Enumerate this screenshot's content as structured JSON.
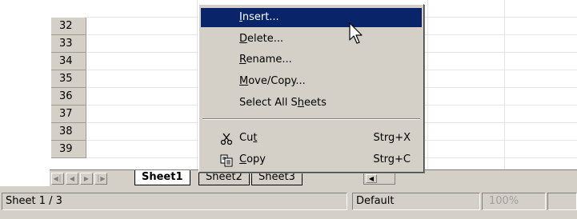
{
  "grid": {
    "rows": [
      "32",
      "33",
      "34",
      "35",
      "36",
      "37",
      "38",
      "39"
    ]
  },
  "context_menu": {
    "items": [
      {
        "pre": "",
        "mn": "I",
        "post": "nsert...",
        "shortcut": ""
      },
      {
        "pre": "",
        "mn": "D",
        "post": "elete...",
        "shortcut": ""
      },
      {
        "pre": "",
        "mn": "R",
        "post": "ename...",
        "shortcut": ""
      },
      {
        "pre": "",
        "mn": "M",
        "post": "ove/Copy...",
        "shortcut": ""
      },
      {
        "pre": "Select All S",
        "mn": "h",
        "post": "eets",
        "shortcut": ""
      },
      {
        "pre": "Cu",
        "mn": "t",
        "post": "",
        "shortcut": "Strg+X"
      },
      {
        "pre": "",
        "mn": "C",
        "post": "opy",
        "shortcut": "Strg+C"
      }
    ]
  },
  "sheet_tabs": [
    "Sheet1",
    "Sheet2",
    "Sheet3"
  ],
  "status": {
    "sheet_info": "Sheet 1 / 3",
    "page_style": "Default",
    "zoom": "100%"
  },
  "colors": {
    "menu_highlight": "#0a246a",
    "chrome": "#d4d0c8"
  }
}
